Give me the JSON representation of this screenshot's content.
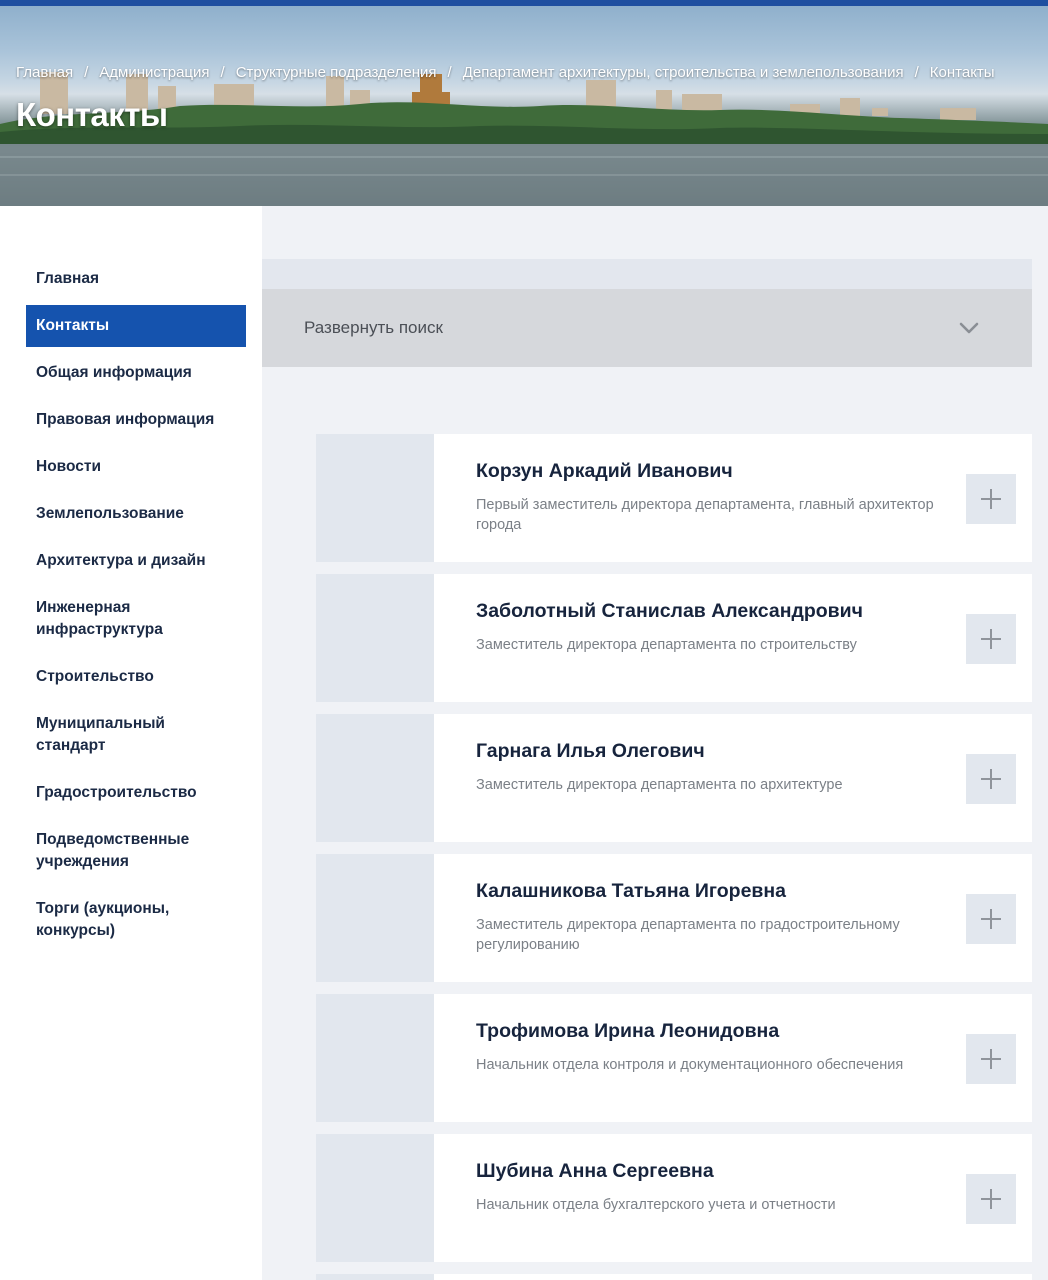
{
  "hero": {
    "breadcrumb": [
      {
        "label": "Главная"
      },
      {
        "label": "Администрация"
      },
      {
        "label": "Структурные подразделения"
      },
      {
        "label": "Департамент архитектуры, строительства и землепользования"
      },
      {
        "label": "Контакты"
      }
    ],
    "separator": "/",
    "title": "Контакты"
  },
  "sidebar": {
    "items": [
      {
        "label": "Главная",
        "active": false
      },
      {
        "label": "Контакты",
        "active": true
      },
      {
        "label": "Общая информация",
        "active": false
      },
      {
        "label": "Правовая информация",
        "active": false
      },
      {
        "label": "Новости",
        "active": false
      },
      {
        "label": "Землепользование",
        "active": false
      },
      {
        "label": "Архитектура и дизайн",
        "active": false
      },
      {
        "label": "Инженерная инфраструктура",
        "active": false
      },
      {
        "label": "Строительство",
        "active": false
      },
      {
        "label": "Муниципальный стандарт",
        "active": false
      },
      {
        "label": "Градостроительство",
        "active": false
      },
      {
        "label": "Подведомственные учреждения",
        "active": false
      },
      {
        "label": "Торги (аукционы, конкурсы)",
        "active": false
      }
    ]
  },
  "search": {
    "label": "Развернуть поиск",
    "icon": "chevron-down-icon"
  },
  "contacts": [
    {
      "name": "Корзун Аркадий Иванович",
      "position": "Первый заместитель директора департамента, главный архитектор города"
    },
    {
      "name": "Заболотный Станислав Александрович",
      "position": "Заместитель директора департамента по строительству"
    },
    {
      "name": "Гарнага Илья Олегович",
      "position": "Заместитель директора департамента по архитектуре"
    },
    {
      "name": "Калашникова Татьяна Игоревна",
      "position": "Заместитель директора департамента по градостроительному регулированию"
    },
    {
      "name": "Трофимова Ирина Леонидовна",
      "position": "Начальник отдела контроля и документационного обеспечения"
    },
    {
      "name": "Шубина Анна Сергеевна",
      "position": "Начальник отдела бухгалтерского учета и отчетности"
    }
  ],
  "icons": {
    "expand": "plus-icon"
  },
  "colors": {
    "accent": "#1553ae",
    "top_line": "#1f4fa0",
    "heading": "#17243d"
  }
}
